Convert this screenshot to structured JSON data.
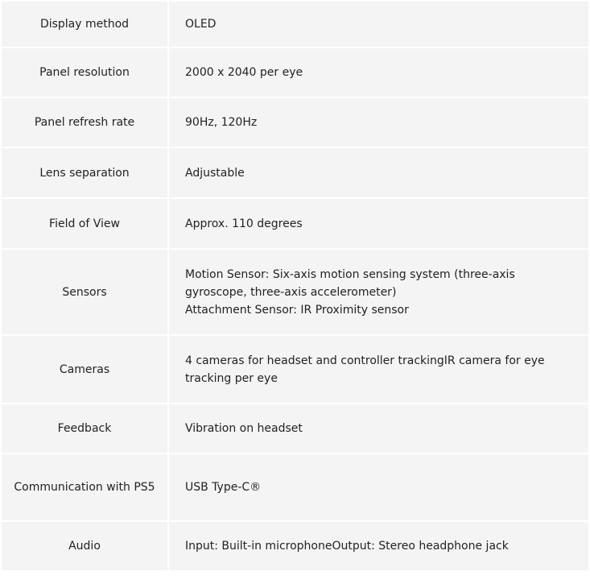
{
  "specs": [
    {
      "label": "Display method",
      "value": [
        "OLED"
      ]
    },
    {
      "label": "Panel resolution",
      "value": [
        "2000 x 2040 per eye"
      ]
    },
    {
      "label": "Panel refresh rate",
      "value": [
        "90Hz, 120Hz"
      ]
    },
    {
      "label": "Lens separation",
      "value": [
        "Adjustable"
      ]
    },
    {
      "label": "Field of View",
      "value": [
        "Approx. 110 degrees"
      ]
    },
    {
      "label": "Sensors",
      "value": [
        "Motion Sensor: Six-axis motion sensing system (three-axis gyroscope, three-axis accelerometer)",
        "Attachment Sensor: IR Proximity sensor"
      ]
    },
    {
      "label": "Cameras",
      "value": [
        "4 cameras for headset and controller trackingIR camera for eye tracking per eye"
      ]
    },
    {
      "label": "Feedback",
      "value": [
        "Vibration on headset"
      ]
    },
    {
      "label": "Communication with PS5",
      "value": [
        "USB Type-C®"
      ]
    },
    {
      "label": "Audio",
      "value": [
        "Input: Built-in microphoneOutput: Stereo headphone jack"
      ]
    }
  ]
}
